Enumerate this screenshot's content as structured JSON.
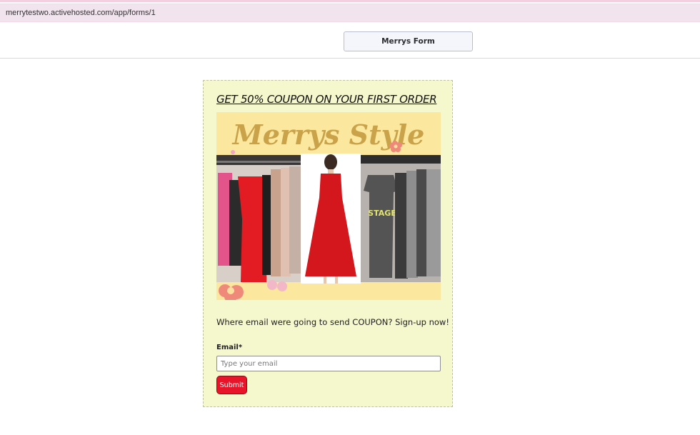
{
  "browser": {
    "url": "merrytestwo.activehosted.com/app/forms/1"
  },
  "header": {
    "form_name": "Merrys Form"
  },
  "form": {
    "heading": "GET 50% COUPON ON YOUR FIRST ORDER",
    "banner": {
      "brand_text": "Merrys Style",
      "shirt_print": "STAGE"
    },
    "intro": "Where email were going to send COUPON? Sign-up now!",
    "email_label": "Email*",
    "email_placeholder": "Type your email",
    "submit_label": "Submit"
  },
  "colors": {
    "card_background": "#f5f7cd",
    "banner_background": "#fbe79e",
    "brand_text": "#c9a24a",
    "submit_background": "#e8152a",
    "address_bar": "#f1e4ee"
  }
}
